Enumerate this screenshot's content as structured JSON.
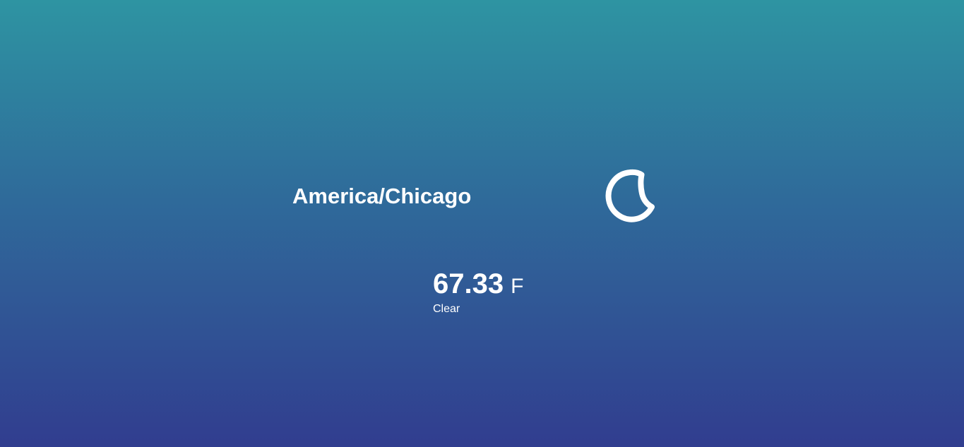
{
  "location": {
    "timezone": "America/Chicago"
  },
  "weather": {
    "icon": "moon-icon",
    "temperature": "67.33",
    "unit": "F",
    "description": "Clear"
  },
  "colors": {
    "gradient_top": "#2e94a2",
    "gradient_middle": "#2f6a9a",
    "gradient_bottom": "#313d8f",
    "text": "#ffffff"
  }
}
